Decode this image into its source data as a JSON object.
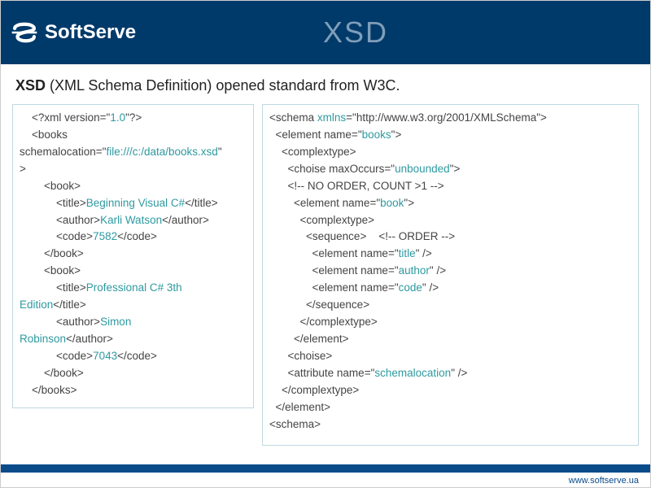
{
  "header": {
    "brand": "SoftServe",
    "title": "XSD"
  },
  "subtitle": {
    "bold": "XSD",
    "rest": " (XML Schema Definition) opened standard from W3C."
  },
  "left": {
    "l1a": "    <?xml version=\"",
    "l1b": "1.0",
    "l1c": "\"?>",
    "l2": "    <books",
    "l3a": "schemalocation=\"",
    "l3b": "file:///c:/data/books.xsd",
    "l3c": "\"",
    "l4": ">",
    "l5": "        <book>",
    "l6a": "            <title>",
    "l6b": "Beginning Visual C#",
    "l6c": "</title>",
    "l7a": "            <author>",
    "l7b": "Karli Watson",
    "l7c": "</author>",
    "l8a": "            <code>",
    "l8b": "7582",
    "l8c": "</code>",
    "l9": "        </book>",
    "l10": "        <book>",
    "l11a": "            <title>",
    "l11b": "Professional C# 3th",
    "l12a": "Edition",
    "l12b": "</title>",
    "l13a": "            <author>",
    "l13b": "Simon",
    "l14a": "Robinson",
    "l14b": "</author>",
    "l15a": "            <code>",
    "l15b": "7043",
    "l15c": "</code>",
    "l16": "        </book>",
    "l17": "    </books>"
  },
  "right": {
    "r1a": "<schema ",
    "r1b": "xmlns",
    "r1c": "=\"http://www.w3.org/2001/XMLSchema\">",
    "r2a": "  <element name=\"",
    "r2b": "books",
    "r2c": "\">",
    "r3": "    <complextype>",
    "r4a": "      <choise maxOccurs=\"",
    "r4b": "unbounded",
    "r4c": "\">",
    "r5": "      <!-- NO ORDER, COUNT >1 -->",
    "r6a": "        <element name=\"",
    "r6b": "book",
    "r6c": "\">",
    "r7": "          <complextype>",
    "r8": "            <sequence>    <!-- ORDER -->",
    "r9a": "              <element name=\"",
    "r9b": "title",
    "r9c": "\" />",
    "r10a": "              <element name=\"",
    "r10b": "author",
    "r10c": "\" />",
    "r11a": "              <element name=\"",
    "r11b": "code",
    "r11c": "\" />",
    "r12": "            </sequence>",
    "r13": "          </complextype>",
    "r14": "        </element>",
    "r15": "      <choise>",
    "r16a": "      <attribute name=\"",
    "r16b": "schemalocation",
    "r16c": "\" />",
    "r17": "    </complextype>",
    "r18": "  </element>",
    "r19": "<schema>"
  },
  "footer": {
    "url": "www.softserve.ua"
  }
}
